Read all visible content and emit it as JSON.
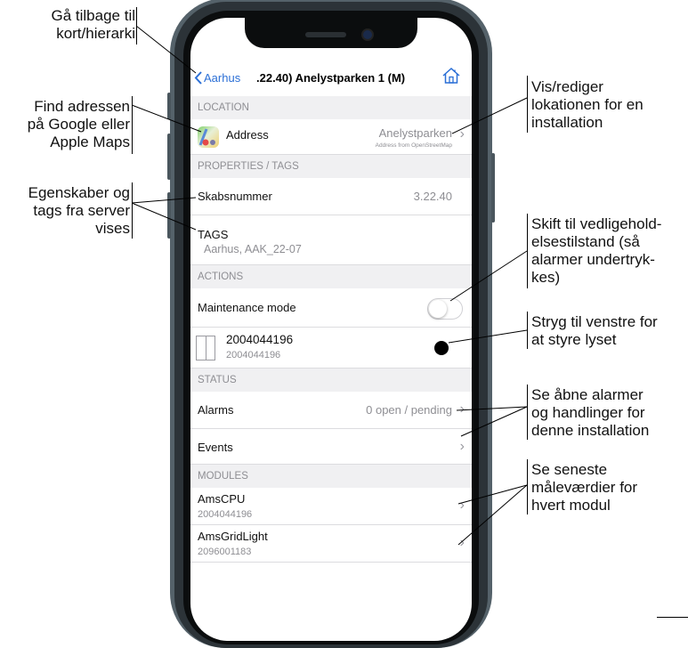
{
  "annotations": {
    "back": "Gå tilbage til\nkort/hierarki",
    "address": "Find adressen\npå Google eller\nApple Maps",
    "properties": "Egenskaber og\ntags fra server\nvises",
    "location": "Vis/rediger\nlokationen for en\ninstallation",
    "maintenance": "Skift til vedligehold-\nelsestilstand (så\nalarmer undertryk-\nkes)",
    "light": "Stryg til venstre for\nat styre lyset",
    "alarms": "Se åbne alarmer\nog handlinger for\ndenne installation",
    "modules": "Se seneste\nmåleværdier for\nhvert modul"
  },
  "nav": {
    "back_label": "Aarhus",
    "title": ".22.40) Anelystparken 1 (M)"
  },
  "sections": {
    "location": "LOCATION",
    "properties": "PROPERTIES / TAGS",
    "actions": "ACTIONS",
    "status": "STATUS",
    "modules": "MODULES"
  },
  "location": {
    "label": "Address",
    "value": "Anelystparken",
    "source": "Address from OpenStreetMap"
  },
  "properties": {
    "cabinet_label": "Skabsnummer",
    "cabinet_value": "3.22.40",
    "tags_label": "TAGS",
    "tags_value": "Aarhus, AAK_22-07"
  },
  "actions": {
    "maintenance_label": "Maintenance mode",
    "maintenance_on": false,
    "light_id": "2004044196",
    "light_sub": "2004044196"
  },
  "status": {
    "alarms_label": "Alarms",
    "alarms_value": "0 open / pending",
    "events_label": "Events"
  },
  "modules": [
    {
      "name": "AmsCPU",
      "id": "2004044196"
    },
    {
      "name": "AmsGridLight",
      "id": "2096001183"
    }
  ],
  "icons": {
    "back": "chevron-left-icon",
    "home": "home-icon",
    "maps": "maps-app-icon",
    "cabinet": "cabinet-icon",
    "chevron": "chevron-right-icon"
  },
  "colors": {
    "accent": "#2b6fd6",
    "section_bg": "#f0f0f2",
    "frame": "#55626a"
  }
}
